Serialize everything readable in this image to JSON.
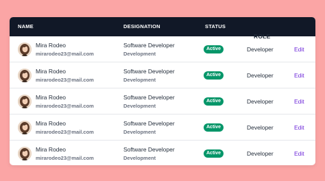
{
  "table": {
    "headers": {
      "name": "NAME",
      "designation": "DESIGNATION",
      "status": "STATUS",
      "role": "ROLE"
    },
    "rows": [
      {
        "name": "Mira Rodeo",
        "email": "mirarodeo23@mail.com",
        "title": "Software Developer",
        "department": "Development",
        "status": "Active",
        "role": "Developer",
        "action": "Edit"
      },
      {
        "name": "Mira Rodeo",
        "email": "mirarodeo23@mail.com",
        "title": "Software Developer",
        "department": "Development",
        "status": "Active",
        "role": "Developer",
        "action": "Edit"
      },
      {
        "name": "Mira Rodeo",
        "email": "mirarodeo23@mail.com",
        "title": "Software Developer",
        "department": "Development",
        "status": "Active",
        "role": "Developer",
        "action": "Edit"
      },
      {
        "name": "Mira Rodeo",
        "email": "mirarodeo23@mail.com",
        "title": "Software Developer",
        "department": "Development",
        "status": "Active",
        "role": "Developer",
        "action": "Edit"
      },
      {
        "name": "Mira Rodeo",
        "email": "mirarodeo23@mail.com",
        "title": "Software Developer",
        "department": "Development",
        "status": "Active",
        "role": "Developer",
        "action": "Edit"
      }
    ]
  },
  "colors": {
    "background": "#fba5a5",
    "header": "#111827",
    "status_active": "#059669",
    "link": "#6d28d9"
  },
  "icons": {
    "avatar": "user-avatar-photo"
  }
}
